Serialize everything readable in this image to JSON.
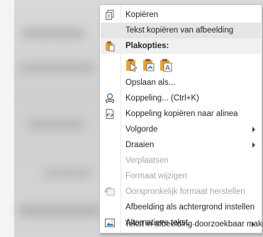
{
  "menu": {
    "items": [
      {
        "label": "Kopiëren",
        "icon": "copy-icon"
      },
      {
        "label": "Tekst kopiëren van afbeelding"
      },
      {
        "label": "Opslaan als..."
      },
      {
        "label": "Koppeling... (Ctrl+K)",
        "icon": "link-icon"
      },
      {
        "label": "Koppeling kopiëren naar alinea",
        "icon": "link-paragraph-icon"
      },
      {
        "label": "Volgorde"
      },
      {
        "label": "Draaien"
      },
      {
        "label": "Verplaatsen"
      },
      {
        "label": "Formaat wijzigen"
      },
      {
        "label": "Oorspronkelijk formaat herstellen",
        "icon": "reset-size-icon"
      },
      {
        "label": "Afbeelding als achtergrond instellen"
      },
      {
        "label": "Alternatieve tekst...",
        "icon": "alt-text-icon"
      },
      {
        "label": "Tekst in afbeelding doorzoekbaar maken"
      }
    ],
    "paste_header": "Plakopties:",
    "paste_options": [
      {
        "icon": "paste-keep-formatting-icon"
      },
      {
        "icon": "paste-merge-formatting-icon"
      },
      {
        "icon": "paste-text-only-icon"
      }
    ]
  },
  "colors": {
    "hover": "#e5e5e5",
    "disabled_text": "#a6a6a6",
    "icon_blue": "#2e75b6",
    "icon_orange": "#e8a33a"
  }
}
